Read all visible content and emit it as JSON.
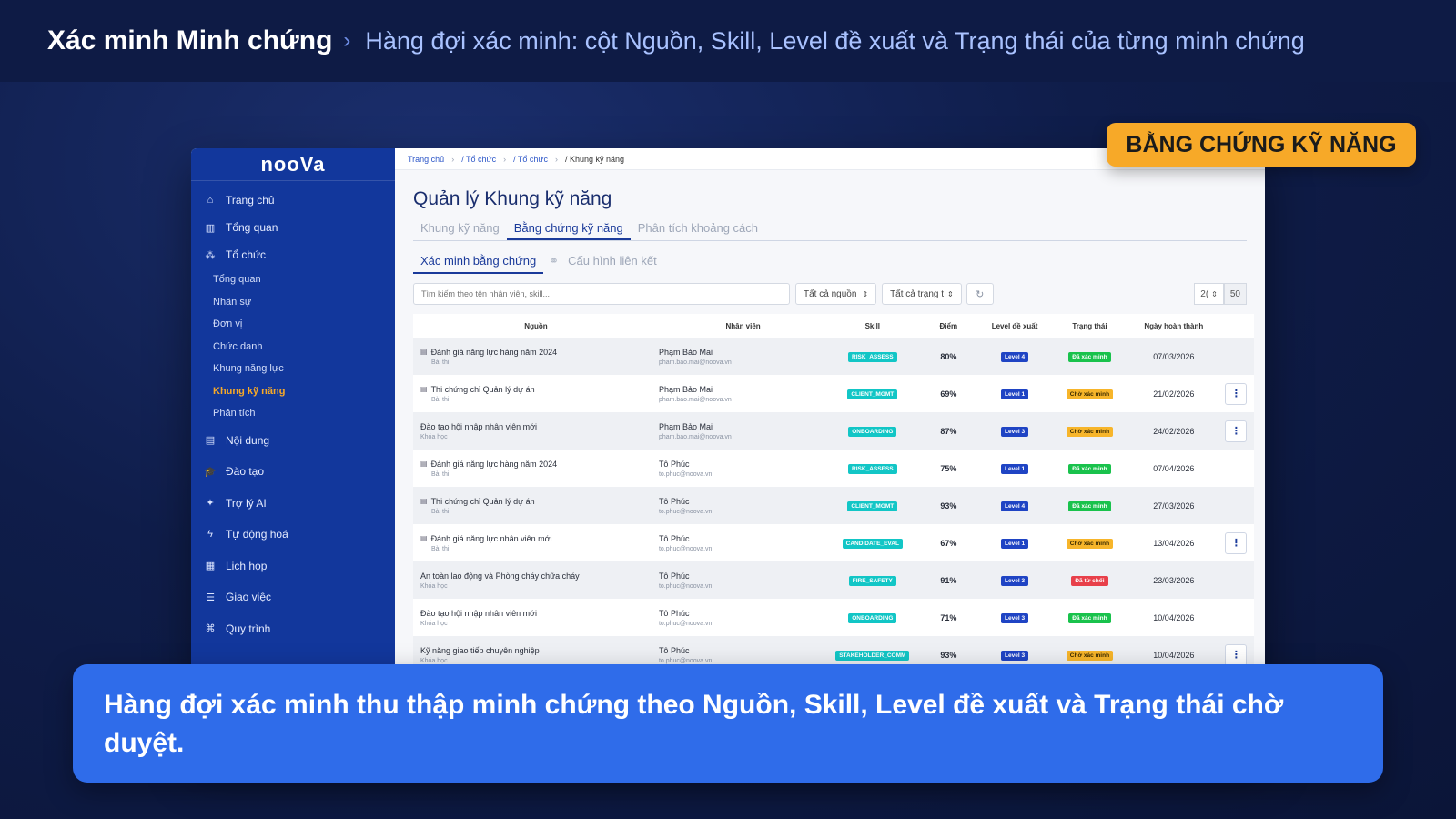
{
  "header": {
    "title": "Xác minh Minh chứng",
    "separator": "›",
    "subtitle": "Hàng đợi xác minh: cột Nguồn, Skill, Level đề xuất và Trạng thái của từng minh chứng"
  },
  "badge": "BẰNG CHỨNG KỸ NĂNG",
  "caption": "Hàng đợi xác minh thu thập minh chứng theo Nguồn, Skill, Level đề xuất và Trạng thái chờ duyệt.",
  "sidebar": {
    "logo": "nooVa",
    "items": [
      {
        "label": "Trang chủ",
        "icon": "home-icon",
        "glyph": "⌂"
      },
      {
        "label": "Tổng quan",
        "icon": "chart-icon",
        "glyph": "▥"
      },
      {
        "label": "Tổ chức",
        "icon": "org-icon",
        "glyph": "⁂"
      }
    ],
    "subitems": [
      "Tổng quan",
      "Nhân sự",
      "Đơn vị",
      "Chức danh",
      "Khung năng lực",
      "Khung kỹ năng",
      "Phân tích"
    ],
    "items2": [
      {
        "label": "Nội dung",
        "icon": "book-icon",
        "glyph": "▤"
      },
      {
        "label": "Đào tạo",
        "icon": "graduation-icon",
        "glyph": "🎓"
      },
      {
        "label": "Trợ lý AI",
        "icon": "sparkle-icon",
        "glyph": "✦"
      },
      {
        "label": "Tự động hoá",
        "icon": "bolt-icon",
        "glyph": "ϟ"
      },
      {
        "label": "Lịch họp",
        "icon": "calendar-icon",
        "glyph": "▦"
      },
      {
        "label": "Giao việc",
        "icon": "task-icon",
        "glyph": "☰"
      },
      {
        "label": "Quy trình",
        "icon": "workflow-icon",
        "glyph": "⌘"
      }
    ]
  },
  "breadcrumb": [
    "Trang chủ",
    "/ Tổ chức",
    "/ Tổ chức",
    "/ Khung kỹ năng"
  ],
  "page_title": "Quản lý Khung kỹ năng",
  "tabs": [
    "Khung kỹ năng",
    "Bằng chứng kỹ năng",
    "Phân tích khoảng cách"
  ],
  "subtabs": [
    "Xác minh bằng chứng",
    "Cấu hình liên kết"
  ],
  "toolbar": {
    "search_placeholder": "Tìm kiếm theo tên nhân viên, skill...",
    "source_filter": "Tất cả nguồn",
    "status_filter": "Tất cả trạng t",
    "page_size": "2(",
    "page_size_alt": "50"
  },
  "table": {
    "headers": [
      "Nguồn",
      "Nhân viên",
      "Skill",
      "Điểm",
      "Level đề xuất",
      "Trạng thái",
      "Ngày hoàn thành"
    ],
    "rows": [
      {
        "source": "Đánh giá năng lực hàng năm 2024",
        "type": "Bài thi",
        "doc": true,
        "name": "Phạm Bảo Mai",
        "email": "pham.bao.mai@noova.vn",
        "skill": "RISK_ASSESS",
        "score": "80%",
        "level": "Level 4",
        "status": "Đã xác minh",
        "st": "ok",
        "date": "07/03/2026",
        "action": false
      },
      {
        "source": "Thi chứng chỉ Quản lý dự án",
        "type": "Bài thi",
        "doc": true,
        "name": "Phạm Bảo Mai",
        "email": "pham.bao.mai@noova.vn",
        "skill": "CLIENT_MGMT",
        "score": "69%",
        "level": "Level 1",
        "status": "Chờ xác minh",
        "st": "wait",
        "date": "21/02/2026",
        "action": true
      },
      {
        "source": "Đào tạo hội nhập nhân viên mới",
        "type": "Khóa học",
        "doc": false,
        "name": "Phạm Bảo Mai",
        "email": "pham.bao.mai@noova.vn",
        "skill": "ONBOARDING",
        "score": "87%",
        "level": "Level 3",
        "status": "Chờ xác minh",
        "st": "wait",
        "date": "24/02/2026",
        "action": true
      },
      {
        "source": "Đánh giá năng lực hàng năm 2024",
        "type": "Bài thi",
        "doc": true,
        "name": "Tô Phúc",
        "email": "to.phuc@noova.vn",
        "skill": "RISK_ASSESS",
        "score": "75%",
        "level": "Level 1",
        "status": "Đã xác minh",
        "st": "ok",
        "date": "07/04/2026",
        "action": false
      },
      {
        "source": "Thi chứng chỉ Quản lý dự án",
        "type": "Bài thi",
        "doc": true,
        "name": "Tô Phúc",
        "email": "to.phuc@noova.vn",
        "skill": "CLIENT_MGMT",
        "score": "93%",
        "level": "Level 4",
        "status": "Đã xác minh",
        "st": "ok",
        "date": "27/03/2026",
        "action": false
      },
      {
        "source": "Đánh giá năng lực nhân viên mới",
        "type": "Bài thi",
        "doc": true,
        "name": "Tô Phúc",
        "email": "to.phuc@noova.vn",
        "skill": "CANDIDATE_EVAL",
        "score": "67%",
        "level": "Level 1",
        "status": "Chờ xác minh",
        "st": "wait",
        "date": "13/04/2026",
        "action": true
      },
      {
        "source": "An toàn lao động và Phòng cháy chữa cháy",
        "type": "Khóa học",
        "doc": false,
        "name": "Tô Phúc",
        "email": "to.phuc@noova.vn",
        "skill": "FIRE_SAFETY",
        "score": "91%",
        "level": "Level 3",
        "status": "Đã từ chối",
        "st": "rej",
        "date": "23/03/2026",
        "action": false
      },
      {
        "source": "Đào tạo hội nhập nhân viên mới",
        "type": "Khóa học",
        "doc": false,
        "name": "Tô Phúc",
        "email": "to.phuc@noova.vn",
        "skill": "ONBOARDING",
        "score": "71%",
        "level": "Level 3",
        "status": "Đã xác minh",
        "st": "ok",
        "date": "10/04/2026",
        "action": false
      },
      {
        "source": "Kỹ năng giao tiếp chuyên nghiệp",
        "type": "Khóa học",
        "doc": false,
        "name": "Tô Phúc",
        "email": "to.phuc@noova.vn",
        "skill": "STAKEHOLDER_COMM",
        "score": "93%",
        "level": "Level 3",
        "status": "Chờ xác minh",
        "st": "wait",
        "date": "10/04/2026",
        "action": true
      }
    ]
  }
}
